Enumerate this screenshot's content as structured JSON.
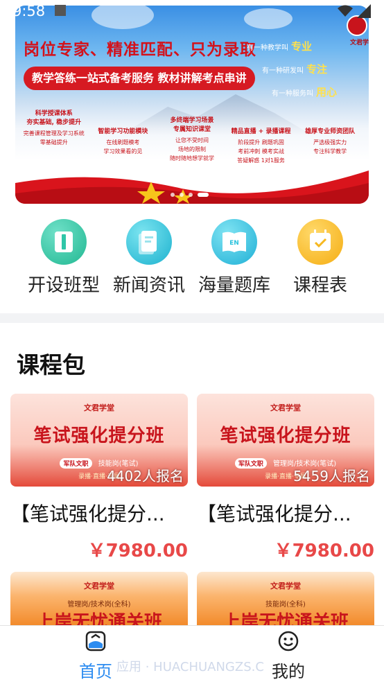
{
  "status_bar": {
    "time": "9:58"
  },
  "banner": {
    "headline": "岗位专家、精准匹配、只为录取",
    "slogan": "教学答练一站式备考服务 教材讲解考点串讲",
    "tags": [
      {
        "prefix": "有一种教学叫",
        "emphasis": "专业"
      },
      {
        "prefix": "有一种研发叫",
        "emphasis": "专注"
      },
      {
        "prefix": "有一种服务叫",
        "emphasis": "用心"
      }
    ],
    "logo_text": "文君学",
    "columns": [
      {
        "title": "科学授课体系\n夯实基础, 稳步提升",
        "text": "完善课程管理及学习系统\n零基础提升"
      },
      {
        "title": "智能学习功能模块",
        "text": "在线刷题模考\n学习效果看的见"
      },
      {
        "title": "多终端学习场景\n专属知识课堂",
        "text": "让您不受时间\n场地的限制\n随时随地想学就学"
      },
      {
        "title": "精品直播 + 录播课程",
        "text": "阶段提升 刷题巩固\n考前冲刺 模考实战\n答疑解惑 1对1服务"
      },
      {
        "title": "雄厚专业师资团队",
        "text": "严选极强实力\n专注科学教学"
      }
    ],
    "dots": 4,
    "active_dot": 3
  },
  "quick_nav": [
    {
      "label": "开设班型",
      "icon": "book-columns-icon",
      "color": "#2fc6a8"
    },
    {
      "label": "新闻资讯",
      "icon": "document-icon",
      "color": "#27c0d6"
    },
    {
      "label": "海量题库",
      "icon": "open-book-en-icon",
      "color": "#2cc3de"
    },
    {
      "label": "课程表",
      "icon": "calendar-check-icon",
      "color": "#f6b81f"
    }
  ],
  "section": {
    "title": "课程包"
  },
  "courses": [
    {
      "brand": "文君学堂",
      "banner_title": "笔试强化提分班",
      "tag": "军队文职",
      "sub": "技能岗(笔试)",
      "foot": "录播·直播·专属",
      "signup": "4402人报名",
      "name": "【笔试强化提分...",
      "price": "￥7980.00"
    },
    {
      "brand": "文君学堂",
      "banner_title": "笔试强化提分班",
      "tag": "军队文职",
      "sub": "管理岗/技术岗(笔试)",
      "foot": "录播·直播·专属",
      "signup": "5459人报名",
      "name": "【笔试强化提分...",
      "price": "￥7980.00"
    },
    {
      "brand": "文君学堂",
      "banner_title": "上岸无忧通关班",
      "sub": "管理岗/技术岗(全科)"
    },
    {
      "brand": "文君学堂",
      "banner_title": "上岸无忧通关班",
      "sub": "技能岗(全科)"
    }
  ],
  "tabs": [
    {
      "label": "首页",
      "icon": "home-icon",
      "active": true,
      "color": "#2d8cf0"
    },
    {
      "label": "我的",
      "icon": "smiley-icon",
      "active": false,
      "color": "#222222"
    }
  ],
  "watermark": "应用 · HUACHUANGZS.C"
}
